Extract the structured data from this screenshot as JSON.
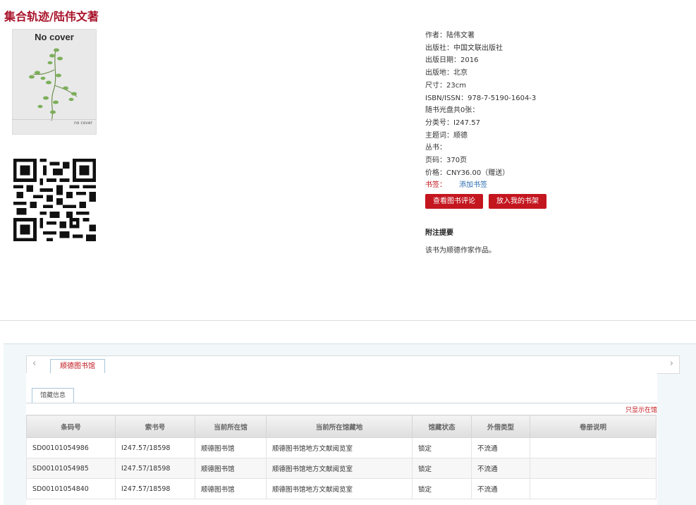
{
  "page_title": "集合轨迹/陆伟文著",
  "cover": {
    "label": "No cover",
    "sublabel": "no cover"
  },
  "meta": [
    "作者：陆伟文著",
    "出版社：中国文联出版社",
    "出版日期：2016",
    "出版地：北京",
    "尺寸：23cm",
    "ISBN/ISSN：978-7-5190-1604-3",
    "随书光盘共0张：",
    "分类号：I247.57",
    "主题词：顺德",
    "丛书：",
    "页码：370页",
    "价格：CNY36.00（赠送）"
  ],
  "bookmark": {
    "label": "书签：",
    "link": "添加书签"
  },
  "buttons": {
    "review": "查看图书评论",
    "shelf": "放入我的书架"
  },
  "note": {
    "heading": "附注提要",
    "text": "该书为顺德作家作品。"
  },
  "tabs": {
    "library": "顺德图书馆",
    "sub": "馆藏信息",
    "left_arrow": "‹",
    "right_arrow": "›"
  },
  "filter_link": "只显示在馆",
  "table": {
    "headers": [
      "条码号",
      "索书号",
      "当前所在馆",
      "当前所在馆藏地",
      "馆藏状态",
      "外借类型",
      "卷册说明"
    ],
    "rows": [
      [
        "SD00101054986",
        "I247.57/18598",
        "顺德图书馆",
        "顺德图书馆地方文献阅览室",
        "锁定",
        "不流通",
        ""
      ],
      [
        "SD00101054985",
        "I247.57/18598",
        "顺德图书馆",
        "顺德图书馆地方文献阅览室",
        "锁定",
        "不流通",
        ""
      ],
      [
        "SD00101054840",
        "I247.57/18598",
        "顺德图书馆",
        "顺德图书馆地方文献阅览室",
        "锁定",
        "不流通",
        ""
      ]
    ]
  },
  "colors": {
    "accent": "#c4161f",
    "link": "#2a6db0",
    "title": "#a8122a"
  }
}
